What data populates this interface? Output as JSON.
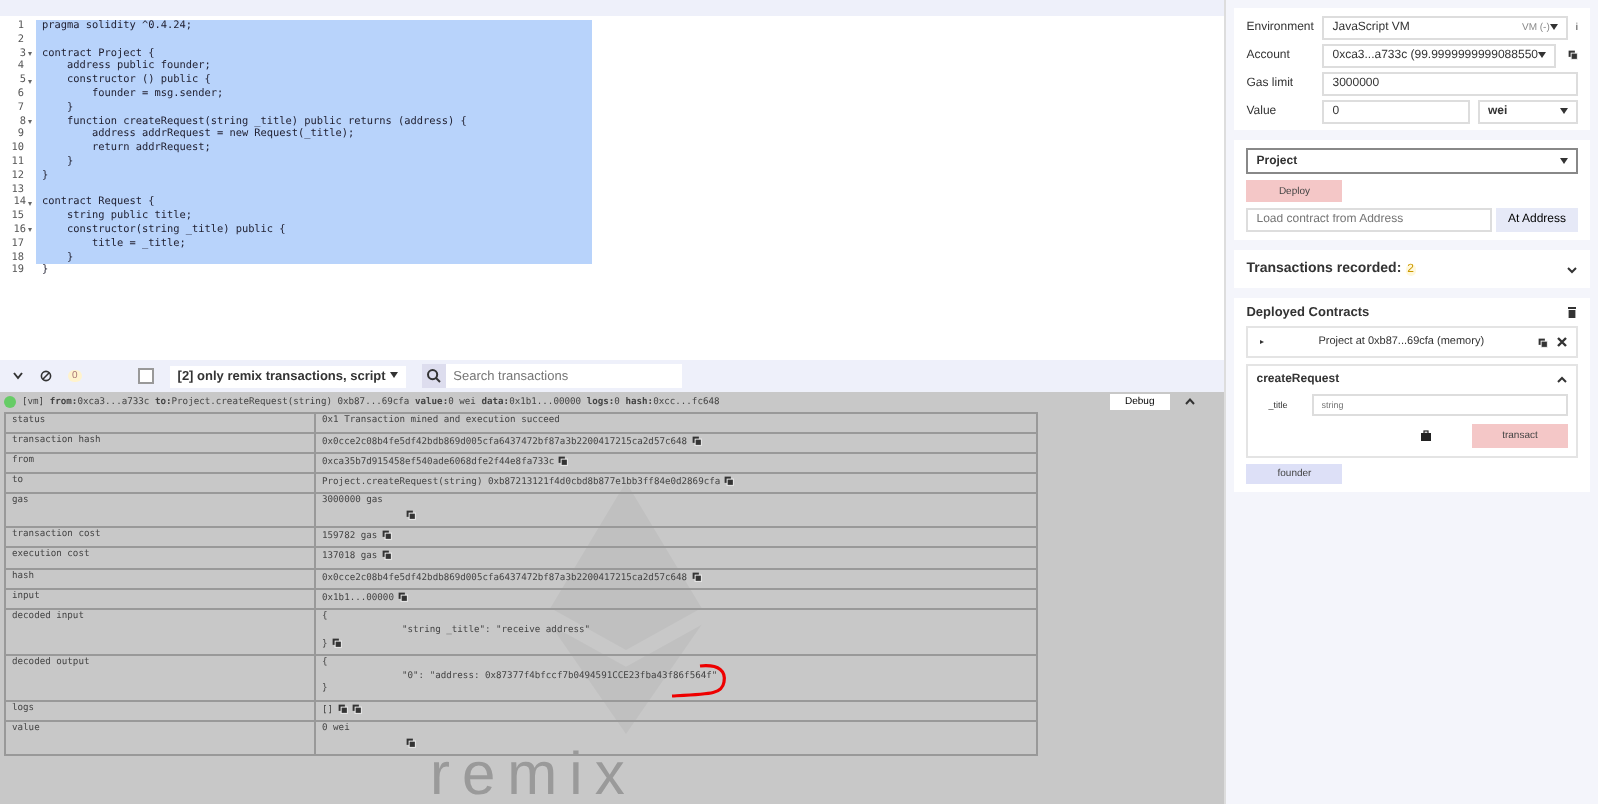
{
  "editor": {
    "lines": [
      {
        "number": "1",
        "text": "pragma solidity ^0.4.24;",
        "fold": false,
        "selected": true
      },
      {
        "number": "2",
        "fold": false,
        "selected": true
      },
      {
        "number": "3",
        "text": "contract Project {",
        "fold": true,
        "selected": true
      },
      {
        "number": "4",
        "text": "    address public founder;",
        "fold": false,
        "selected": true
      },
      {
        "number": "5",
        "text": "    constructor () public {",
        "fold": true,
        "selected": true
      },
      {
        "number": "6",
        "text": "        founder = msg.sender;",
        "fold": false,
        "selected": true
      },
      {
        "number": "7",
        "text": "    }",
        "fold": false,
        "selected": true
      },
      {
        "number": "8",
        "text": "    function createRequest(string _title) public returns (address) {",
        "fold": true,
        "selected": true
      },
      {
        "number": "9",
        "text": "        address addrRequest = new Request(_title);",
        "fold": false,
        "selected": true
      },
      {
        "number": "10",
        "text": "        return addrRequest;",
        "fold": false,
        "selected": true
      },
      {
        "number": "11",
        "text": "    }",
        "fold": false,
        "selected": true
      },
      {
        "number": "12",
        "text": "}",
        "fold": false,
        "selected": true
      },
      {
        "number": "13",
        "fold": false,
        "selected": true
      },
      {
        "number": "14",
        "text": "contract Request {",
        "fold": true,
        "selected": true
      },
      {
        "number": "15",
        "text": "    string public title;",
        "fold": false,
        "selected": true
      },
      {
        "number": "16",
        "text": "    constructor(string _title) public {",
        "fold": true,
        "selected": true
      },
      {
        "number": "17",
        "text": "        title = _title;",
        "fold": false,
        "selected": true
      },
      {
        "number": "18",
        "text": "    }",
        "fold": false,
        "selected": true
      },
      {
        "number": "19",
        "text": "}",
        "fold": false,
        "selected": false
      }
    ]
  },
  "terminal": {
    "pending_count": "0",
    "filter_checked": false,
    "filter_label": "[2] only remix transactions, script",
    "search_placeholder": "Search transactions",
    "log": {
      "prefix": "[vm]",
      "parts": [
        {
          "key": "from:",
          "value": "0xca3...a733c"
        },
        {
          "key": "to:",
          "value": "Project.createRequest(string) 0xb87...69cfa"
        },
        {
          "key": "value:",
          "value": "0 wei"
        },
        {
          "key": "data:",
          "value": "0x1b1...00000"
        },
        {
          "key": "logs:",
          "value": "0"
        },
        {
          "key": "hash:",
          "value": "0xcc...fc648"
        }
      ],
      "button": "Debug"
    },
    "rows": [
      {
        "label": "status",
        "lines": [
          "0x1 Transaction mined and execution succeed"
        ],
        "copy": false
      },
      {
        "label": "transaction hash",
        "lines": [
          "0x0cce2c08b4fe5df42bdb869d005cfa6437472bf87a3b2200417215ca2d57c648"
        ],
        "copy": true
      },
      {
        "label": "from",
        "lines": [
          "0xca35b7d915458ef540ade6068dfe2f44e8fa733c"
        ],
        "copy": true
      },
      {
        "label": "to",
        "lines": [
          "Project.createRequest(string) 0xb87213121f4d0cbd8b877e1bb3ff84e0d2869cfa"
        ],
        "copy": true
      },
      {
        "label": "gas",
        "lines": [
          "3000000 gas"
        ],
        "copy": true,
        "copy_below": true
      },
      {
        "label": "transaction cost",
        "lines": [
          "159782 gas"
        ],
        "copy": true
      },
      {
        "label": "execution cost",
        "lines": [
          "137018 gas"
        ],
        "copy": true
      },
      {
        "label": "hash",
        "lines": [
          "0x0cce2c08b4fe5df42bdb869d005cfa6437472bf87a3b2200417215ca2d57c648"
        ],
        "copy": true
      },
      {
        "label": "input",
        "lines": [
          "0x1b1...00000"
        ],
        "copy": true
      },
      {
        "label": "decoded input",
        "lines": [
          "{",
          "\"string _title\": \"receive address\"",
          "}"
        ],
        "copy": true
      },
      {
        "label": "decoded output",
        "lines": [
          "{",
          "\"0\": \"address: 0x87377f4bfccf7b0494591CCE23fba43f86f564f\"",
          "}"
        ],
        "copy": false,
        "marked": true
      },
      {
        "label": "logs",
        "lines": [
          "[]"
        ],
        "copy": true,
        "copy_double": true
      },
      {
        "label": "value",
        "lines": [
          "0 wei"
        ],
        "copy": true,
        "copy_below": true
      }
    ],
    "background_logo_text": "remix"
  },
  "run_panel": {
    "fields": [
      {
        "kind": "select",
        "label": "Environment",
        "value": "JavaScript VM",
        "badge": "VM (-)",
        "info": "i"
      },
      {
        "kind": "select",
        "label": "Account",
        "value": "0xca3...a733c (99.9999999999088550",
        "copy": true
      },
      {
        "kind": "input",
        "label": "Gas limit",
        "value": "3000000"
      },
      {
        "kind": "unit",
        "label": "Value",
        "value": "0",
        "unit": "wei"
      }
    ],
    "contract_select": "Project",
    "deploy_button": "Deploy",
    "address_placeholder": "Load contract from Address",
    "at_address_button": "At Address",
    "transactions_recorded": {
      "label": "Transactions recorded:",
      "count": "2"
    },
    "deployed": {
      "title": "Deployed Contracts",
      "instance": "Project at 0xb87...69cfa (memory)",
      "function": {
        "name": "createRequest",
        "expanded": true,
        "param_label": "_title",
        "param_placeholder": "string",
        "button": "transact"
      },
      "getters": [
        "founder"
      ]
    }
  }
}
